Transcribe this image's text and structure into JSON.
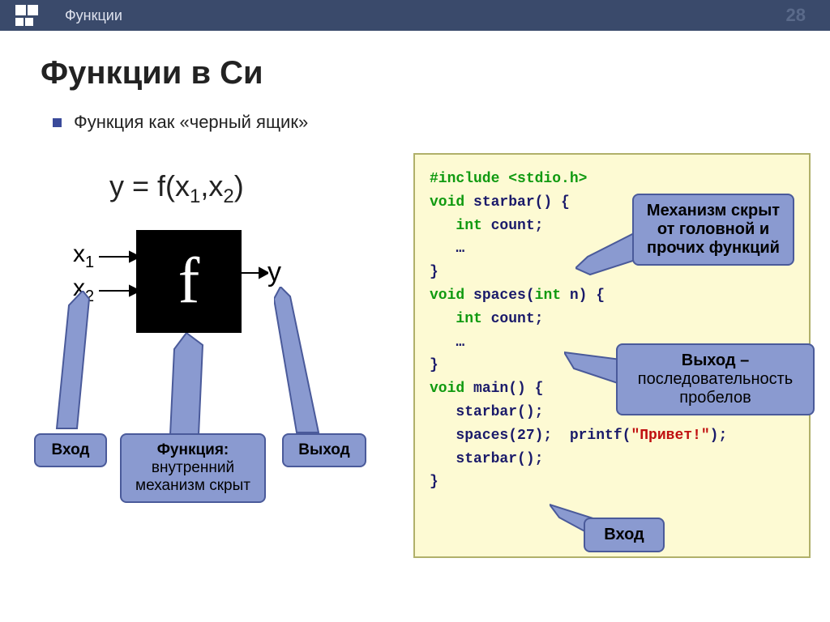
{
  "header": {
    "title": "Функции",
    "page_number": "28"
  },
  "slide": {
    "title": "Функции в Си",
    "bullet": "Функция как «черный ящик»"
  },
  "diagram": {
    "formula_prefix": "y = f(x",
    "formula_mid": ",x",
    "formula_suffix_1": "1",
    "formula_suffix_2": "2",
    "formula_close": ")",
    "x1": "x",
    "x1_sub": "1",
    "x2": "x",
    "x2_sub": "2",
    "f": "f",
    "y": "y",
    "callouts": {
      "input": "Вход",
      "function_title": "Функция:",
      "function_body": "внутренний механизм скрыт",
      "output": "Выход"
    }
  },
  "code": {
    "l1": "#include <stdio.h>",
    "l2": "",
    "l3_a": "void",
    "l3_b": " starbar() {",
    "l4_a": "   int",
    "l4_b": " count;",
    "l5": "   …",
    "l6": "}",
    "l7": "",
    "l8_a": "void",
    "l8_b": " spaces(",
    "l8_c": "int",
    "l8_d": " n) {",
    "l9_a": "   int",
    "l9_b": " count;",
    "l10": "   …",
    "l11": "}",
    "l12": "",
    "l13_a": "void",
    "l13_b": " main() {",
    "l14": "   starbar();",
    "l15_a": "   spaces(27);  printf(",
    "l15_b": "\"Привет!\"",
    "l15_c": ");",
    "l16": "   starbar();",
    "l17": "}"
  },
  "right_callouts": {
    "mechanism": "Механизм скрыт от головной и прочих функций",
    "output_title": "Выход –",
    "output_body": "последовательность пробелов",
    "input": "Вход"
  }
}
